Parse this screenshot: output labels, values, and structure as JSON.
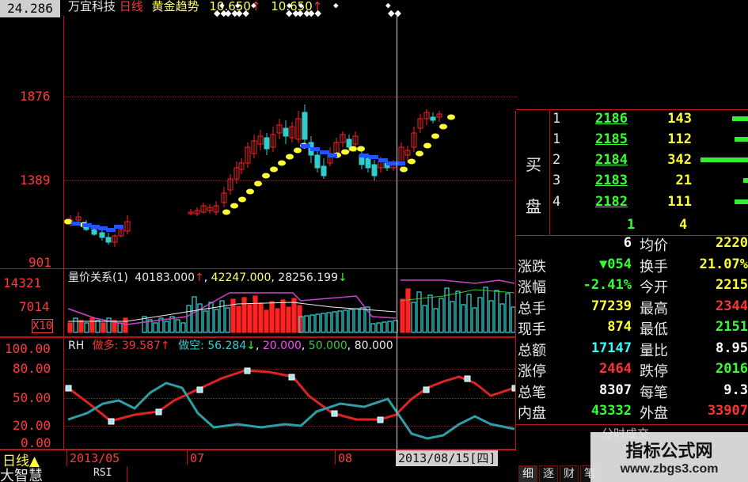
{
  "price_panel": {
    "corner_value": "24.286",
    "title_stock": "万宜科技",
    "title_period": "日线",
    "title_indicator": "黄金趋势",
    "title_v1": "10.650",
    "title_v2": "10.650",
    "y_ticks": [
      "1876",
      "1389",
      "901"
    ]
  },
  "volume_panel": {
    "ticks": [
      "14321",
      "7014",
      "X10"
    ],
    "label": "量价关系(1)",
    "v1": "40183.000",
    "v2": "42247.000",
    "v3": "28256.199"
  },
  "rsi_panel": {
    "name": "RH",
    "long_label": "做多:",
    "long_value": "39.587",
    "short_label": "做空:",
    "short_value": "56.284",
    "lvl1": "20.000",
    "lvl2": "50.000",
    "lvl3": "80.000",
    "y_ticks": [
      "100.00",
      "80.00",
      "50.00",
      "20.00",
      "0.00"
    ]
  },
  "bottom": {
    "period": "日线",
    "app_name": "大智慧",
    "date_1": "2013/05",
    "month_2": "07",
    "month_3": "08",
    "cursor_date": "2013/08/15[四]",
    "indicator_tab": "RSI",
    "tabs": [
      "细",
      "逐",
      "财",
      "笔"
    ]
  },
  "order_book": {
    "side_char_1": "买",
    "side_char_2": "盘",
    "rows": [
      {
        "level": "1",
        "price": "2186",
        "volume": "143",
        "bar": 0.2
      },
      {
        "level": "1",
        "price": "2185",
        "volume": "112",
        "bar": 0.17
      },
      {
        "level": "2",
        "price": "2184",
        "volume": "342",
        "bar": 0.6
      },
      {
        "level": "3",
        "price": "2183",
        "volume": "21",
        "bar": 0.05
      },
      {
        "level": "4",
        "price": "2182",
        "volume": "111",
        "bar": 0.17
      }
    ],
    "partial_row_price": "1",
    "partial_row_volume": "4"
  },
  "quote": {
    "rows": [
      {
        "l1": "",
        "v1": "6",
        "l2": "均价",
        "v2": "2220",
        "c1": "#ffffff",
        "c2": "#ffff33"
      },
      {
        "l1": "涨跌",
        "v1": "▼054",
        "l2": "换手",
        "v2": "21.07%",
        "c1": "#33ff33",
        "c2": "#ffff33"
      },
      {
        "l1": "涨幅",
        "v1": "-2.41%",
        "l2": "今开",
        "v2": "2215",
        "c1": "#33ff33",
        "c2": "#ffff33"
      },
      {
        "l1": "总手",
        "v1": "77239",
        "l2": "最高",
        "v2": "2344",
        "c1": "#ffff33",
        "c2": "#ff3333"
      },
      {
        "l1": "现手",
        "v1": "874",
        "l2": "最低",
        "v2": "2151",
        "c1": "#ffff33",
        "c2": "#33ff33"
      },
      {
        "l1": "总额",
        "v1": "17147",
        "l2": "量比",
        "v2": "8.95",
        "c1": "#33ffff",
        "c2": "#ffffff"
      },
      {
        "l1": "涨停",
        "v1": "2464",
        "l2": "跌停",
        "v2": "2016",
        "c1": "#ff3333",
        "c2": "#33ff33"
      },
      {
        "l1": "总笔",
        "v1": "8307",
        "l2": "每笔",
        "v2": "9.3",
        "c1": "#ffffff",
        "c2": "#ffffff"
      },
      {
        "l1": "内盘",
        "v1": "43332",
        "l2": "外盘",
        "v2": "33907",
        "c1": "#33ff33",
        "c2": "#ff3333"
      }
    ],
    "bottom_label": "分时成交"
  },
  "watermark": {
    "line1": "指标公式网",
    "line2": "www.zbgs3.com"
  }
}
